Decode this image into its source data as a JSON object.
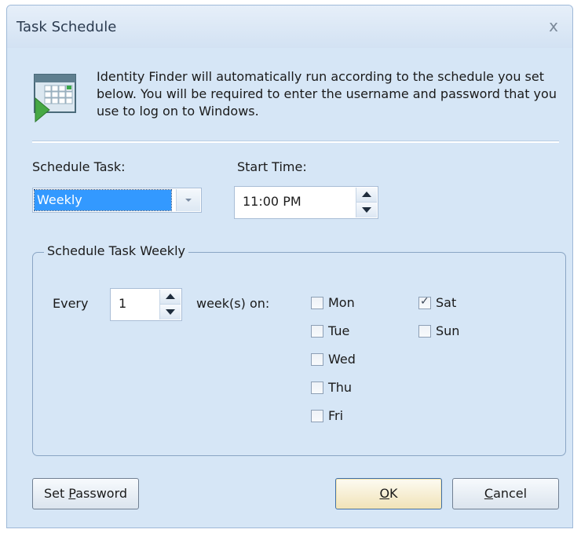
{
  "window": {
    "title": "Task Schedule",
    "close_glyph": "x",
    "intro_text": "Identity Finder will automatically run according to the schedule you set below.  You will be required to enter the username and password that you use to log on to Windows."
  },
  "schedule": {
    "label": "Schedule Task:",
    "value": "Weekly"
  },
  "start_time": {
    "label": "Start Time:",
    "value": "11:00 PM"
  },
  "weekly_group": {
    "title": "Schedule Task Weekly",
    "every_label": "Every",
    "every_value": "1",
    "weeks_label": "week(s) on:",
    "days": [
      {
        "label": "Mon",
        "checked": false
      },
      {
        "label": "Tue",
        "checked": false
      },
      {
        "label": "Wed",
        "checked": false
      },
      {
        "label": "Thu",
        "checked": false
      },
      {
        "label": "Fri",
        "checked": false
      },
      {
        "label": "Sat",
        "checked": true
      },
      {
        "label": "Sun",
        "checked": false
      }
    ]
  },
  "buttons": {
    "set_password": {
      "pre": "Set ",
      "mnemonic": "P",
      "post": "assword"
    },
    "ok": {
      "pre": "",
      "mnemonic": "O",
      "post": "K"
    },
    "cancel": {
      "pre": "",
      "mnemonic": "C",
      "post": "ancel"
    }
  },
  "icons": {
    "close": "close-icon",
    "calendar": "calendar-icon",
    "dropdown": "chevron-down-icon",
    "spin_up": "arrow-up-icon",
    "spin_down": "arrow-down-icon",
    "checkmark": "checkmark-icon"
  },
  "colors": {
    "dialog_bg": "#d6e6f6",
    "selection": "#3399ff",
    "default_button": "#f1e3b8"
  }
}
